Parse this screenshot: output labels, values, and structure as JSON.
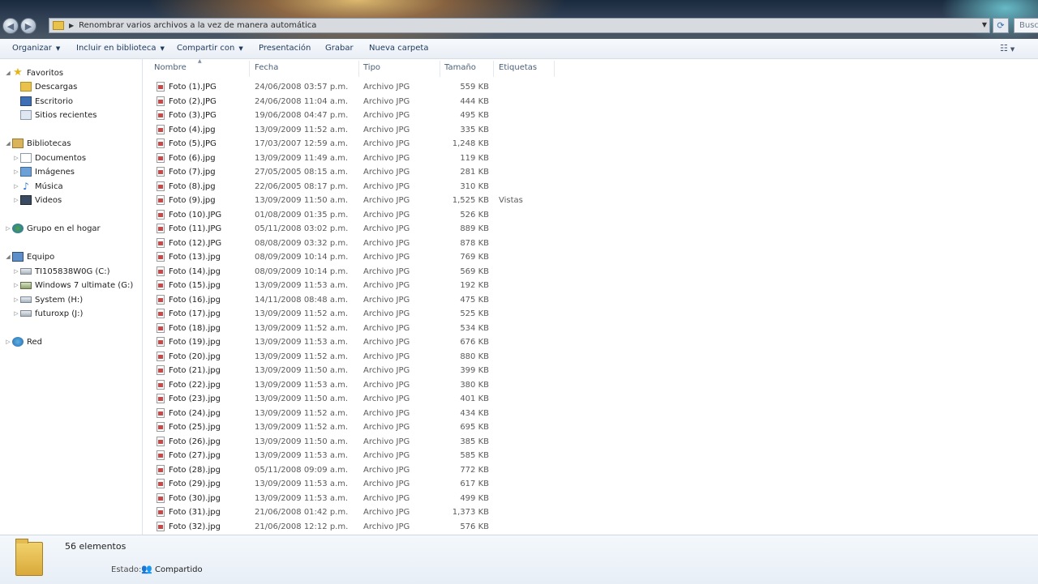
{
  "address": {
    "path": "Renombrar varios archivos a la vez de manera automática",
    "search_placeholder": "Buscar"
  },
  "toolbar": {
    "organizar": "Organizar",
    "incluir": "Incluir en biblioteca",
    "compartir": "Compartir con",
    "presentacion": "Presentación",
    "grabar": "Grabar",
    "nueva_carpeta": "Nueva carpeta"
  },
  "nav": {
    "favoritos": "Favoritos",
    "descargas": "Descargas",
    "escritorio": "Escritorio",
    "sitios_recientes": "Sitios recientes",
    "bibliotecas": "Bibliotecas",
    "documentos": "Documentos",
    "imagenes": "Imágenes",
    "musica": "Música",
    "videos": "Videos",
    "grupo_hogar": "Grupo en el hogar",
    "equipo": "Equipo",
    "drive_c": "TI105838W0G (C:)",
    "drive_g": "Windows 7 ultimate (G:)",
    "drive_h": "System (H:)",
    "drive_j": "futuroxp (J:)",
    "red": "Red"
  },
  "columns": {
    "nombre": "Nombre",
    "fecha": "Fecha",
    "tipo": "Tipo",
    "tamano": "Tamaño",
    "etiquetas": "Etiquetas"
  },
  "files": [
    {
      "name": "Foto  (1).JPG",
      "date": "24/06/2008 03:57 p.m.",
      "type": "Archivo JPG",
      "size": "559 KB",
      "tag": ""
    },
    {
      "name": "Foto  (2).JPG",
      "date": "24/06/2008 11:04 a.m.",
      "type": "Archivo JPG",
      "size": "444 KB",
      "tag": ""
    },
    {
      "name": "Foto  (3).JPG",
      "date": "19/06/2008 04:47 p.m.",
      "type": "Archivo JPG",
      "size": "495 KB",
      "tag": ""
    },
    {
      "name": "Foto  (4).jpg",
      "date": "13/09/2009 11:52 a.m.",
      "type": "Archivo JPG",
      "size": "335 KB",
      "tag": ""
    },
    {
      "name": "Foto  (5).JPG",
      "date": "17/03/2007 12:59 a.m.",
      "type": "Archivo JPG",
      "size": "1,248 KB",
      "tag": ""
    },
    {
      "name": "Foto  (6).jpg",
      "date": "13/09/2009 11:49 a.m.",
      "type": "Archivo JPG",
      "size": "119 KB",
      "tag": ""
    },
    {
      "name": "Foto  (7).jpg",
      "date": "27/05/2005 08:15 a.m.",
      "type": "Archivo JPG",
      "size": "281 KB",
      "tag": ""
    },
    {
      "name": "Foto  (8).jpg",
      "date": "22/06/2005 08:17 p.m.",
      "type": "Archivo JPG",
      "size": "310 KB",
      "tag": ""
    },
    {
      "name": "Foto  (9).jpg",
      "date": "13/09/2009 11:50 a.m.",
      "type": "Archivo JPG",
      "size": "1,525 KB",
      "tag": "Vistas"
    },
    {
      "name": "Foto  (10).JPG",
      "date": "01/08/2009 01:35 p.m.",
      "type": "Archivo JPG",
      "size": "526 KB",
      "tag": ""
    },
    {
      "name": "Foto  (11).JPG",
      "date": "05/11/2008 03:02 p.m.",
      "type": "Archivo JPG",
      "size": "889 KB",
      "tag": ""
    },
    {
      "name": "Foto  (12).JPG",
      "date": "08/08/2009 03:32 p.m.",
      "type": "Archivo JPG",
      "size": "878 KB",
      "tag": ""
    },
    {
      "name": "Foto  (13).jpg",
      "date": "08/09/2009 10:14 p.m.",
      "type": "Archivo JPG",
      "size": "769 KB",
      "tag": ""
    },
    {
      "name": "Foto  (14).jpg",
      "date": "08/09/2009 10:14 p.m.",
      "type": "Archivo JPG",
      "size": "569 KB",
      "tag": ""
    },
    {
      "name": "Foto  (15).jpg",
      "date": "13/09/2009 11:53 a.m.",
      "type": "Archivo JPG",
      "size": "192 KB",
      "tag": ""
    },
    {
      "name": "Foto  (16).jpg",
      "date": "14/11/2008 08:48 a.m.",
      "type": "Archivo JPG",
      "size": "475 KB",
      "tag": ""
    },
    {
      "name": "Foto  (17).jpg",
      "date": "13/09/2009 11:52 a.m.",
      "type": "Archivo JPG",
      "size": "525 KB",
      "tag": ""
    },
    {
      "name": "Foto  (18).jpg",
      "date": "13/09/2009 11:52 a.m.",
      "type": "Archivo JPG",
      "size": "534 KB",
      "tag": ""
    },
    {
      "name": "Foto  (19).jpg",
      "date": "13/09/2009 11:53 a.m.",
      "type": "Archivo JPG",
      "size": "676 KB",
      "tag": ""
    },
    {
      "name": "Foto  (20).jpg",
      "date": "13/09/2009 11:52 a.m.",
      "type": "Archivo JPG",
      "size": "880 KB",
      "tag": ""
    },
    {
      "name": "Foto  (21).jpg",
      "date": "13/09/2009 11:50 a.m.",
      "type": "Archivo JPG",
      "size": "399 KB",
      "tag": ""
    },
    {
      "name": "Foto  (22).jpg",
      "date": "13/09/2009 11:53 a.m.",
      "type": "Archivo JPG",
      "size": "380 KB",
      "tag": ""
    },
    {
      "name": "Foto  (23).jpg",
      "date": "13/09/2009 11:50 a.m.",
      "type": "Archivo JPG",
      "size": "401 KB",
      "tag": ""
    },
    {
      "name": "Foto  (24).jpg",
      "date": "13/09/2009 11:52 a.m.",
      "type": "Archivo JPG",
      "size": "434 KB",
      "tag": ""
    },
    {
      "name": "Foto  (25).jpg",
      "date": "13/09/2009 11:52 a.m.",
      "type": "Archivo JPG",
      "size": "695 KB",
      "tag": ""
    },
    {
      "name": "Foto  (26).jpg",
      "date": "13/09/2009 11:50 a.m.",
      "type": "Archivo JPG",
      "size": "385 KB",
      "tag": ""
    },
    {
      "name": "Foto  (27).jpg",
      "date": "13/09/2009 11:53 a.m.",
      "type": "Archivo JPG",
      "size": "585 KB",
      "tag": ""
    },
    {
      "name": "Foto  (28).jpg",
      "date": "05/11/2008 09:09 a.m.",
      "type": "Archivo JPG",
      "size": "772 KB",
      "tag": ""
    },
    {
      "name": "Foto  (29).jpg",
      "date": "13/09/2009 11:53 a.m.",
      "type": "Archivo JPG",
      "size": "617 KB",
      "tag": ""
    },
    {
      "name": "Foto  (30).jpg",
      "date": "13/09/2009 11:53 a.m.",
      "type": "Archivo JPG",
      "size": "499 KB",
      "tag": ""
    },
    {
      "name": "Foto  (31).jpg",
      "date": "21/06/2008 01:42 p.m.",
      "type": "Archivo JPG",
      "size": "1,373 KB",
      "tag": ""
    },
    {
      "name": "Foto  (32).jpg",
      "date": "21/06/2008 12:12 p.m.",
      "type": "Archivo JPG",
      "size": "576 KB",
      "tag": ""
    }
  ],
  "details": {
    "count": "56 elementos",
    "status_label": "Estado:",
    "status_value": "Compartido"
  }
}
